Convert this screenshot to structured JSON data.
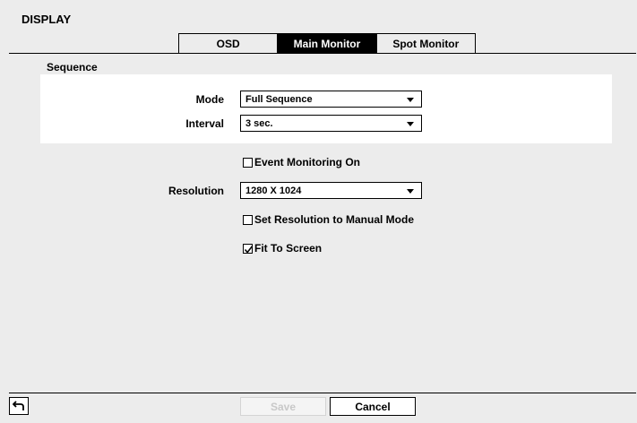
{
  "window": {
    "title": "DISPLAY"
  },
  "tabs": [
    {
      "label": "OSD",
      "active": false
    },
    {
      "label": "Main Monitor",
      "active": true
    },
    {
      "label": "Spot Monitor",
      "active": false
    }
  ],
  "sequence": {
    "section_label": "Sequence",
    "mode": {
      "label": "Mode",
      "value": "Full Sequence"
    },
    "interval": {
      "label": "Interval",
      "value": "3 sec."
    }
  },
  "event_monitoring": {
    "label": "Event Monitoring On",
    "checked": false
  },
  "resolution": {
    "label": "Resolution",
    "value": "1280 X 1024"
  },
  "manual_mode": {
    "label": "Set Resolution to Manual Mode",
    "checked": false
  },
  "fit_to_screen": {
    "label": "Fit To Screen",
    "checked": true
  },
  "footer": {
    "save_label": "Save",
    "cancel_label": "Cancel",
    "back_icon": "back-arrow-icon"
  }
}
